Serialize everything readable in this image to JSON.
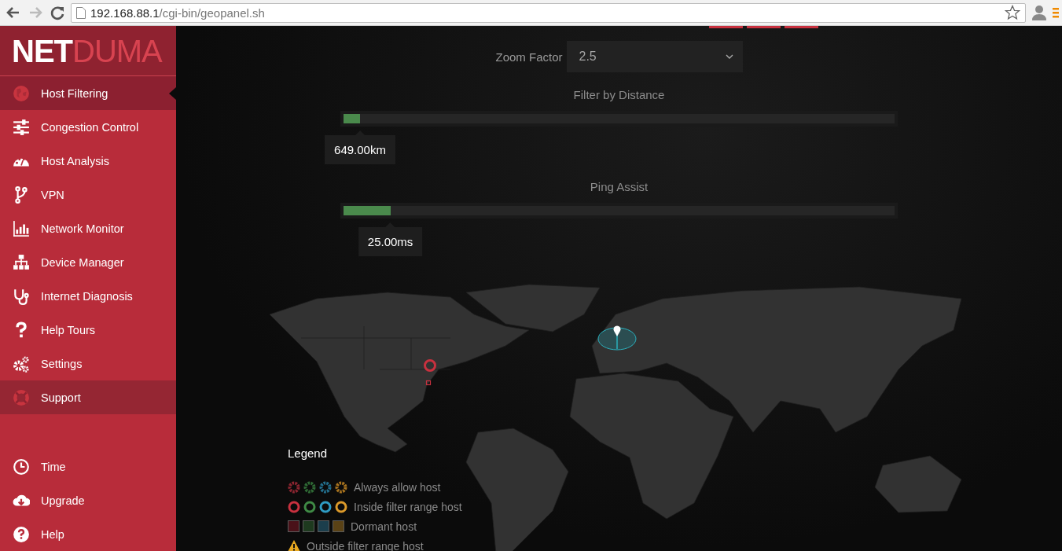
{
  "browser": {
    "url_host": "192.168.88.1",
    "url_path": "/cgi-bin/geopanel.sh",
    "forward_disabled": true
  },
  "sidebar": {
    "logo_strong": "NET",
    "logo_light": "DUMA",
    "items": [
      {
        "label": "Host Filtering",
        "selected": true,
        "hovered": false
      },
      {
        "label": "Congestion Control",
        "selected": false,
        "hovered": false
      },
      {
        "label": "Host Analysis",
        "selected": false,
        "hovered": false
      },
      {
        "label": "VPN",
        "selected": false,
        "hovered": false
      },
      {
        "label": "Network Monitor",
        "selected": false,
        "hovered": false
      },
      {
        "label": "Device Manager",
        "selected": false,
        "hovered": false
      },
      {
        "label": "Internet Diagnosis",
        "selected": false,
        "hovered": false
      },
      {
        "label": "Help Tours",
        "selected": false,
        "hovered": false
      },
      {
        "label": "Settings",
        "selected": false,
        "hovered": false
      },
      {
        "label": "Support",
        "selected": false,
        "hovered": true
      }
    ],
    "bottom_items": [
      {
        "label": "Time"
      },
      {
        "label": "Upgrade"
      },
      {
        "label": "Help"
      }
    ]
  },
  "zoom": {
    "label": "Zoom Factor",
    "value": "2.5"
  },
  "sliders": [
    {
      "label": "Filter by Distance",
      "level": 0.03,
      "reading": "649.00km"
    },
    {
      "label": "Ping Assist",
      "level": 0.085,
      "reading": "25.00ms"
    }
  ],
  "map": {
    "hosts": [
      {
        "kind": "inside",
        "color": "#c8313f"
      },
      {
        "kind": "dormant",
        "color": "#c8313f"
      }
    ]
  },
  "legend": {
    "title": "Legend",
    "rows": [
      {
        "kind": "always",
        "label": "Always allow host",
        "swatches": [
          {
            "color": "#8a2530"
          },
          {
            "color": "#2f6a35"
          },
          {
            "color": "#236e8c"
          },
          {
            "color": "#a8731f"
          }
        ]
      },
      {
        "kind": "inside",
        "label": "Inside filter range host",
        "swatches": [
          {
            "color": "#c8313f"
          },
          {
            "color": "#3f8a45"
          },
          {
            "color": "#2f9cc4"
          },
          {
            "color": "#dc9a2a"
          }
        ]
      },
      {
        "kind": "dormant",
        "label": "Dormant host",
        "swatches": [
          {
            "color": "#4a1219"
          },
          {
            "color": "#1e3a1f"
          },
          {
            "color": "#1b3e4c"
          },
          {
            "color": "#5a4216"
          }
        ]
      },
      {
        "kind": "outside",
        "label": "Outside filter range host",
        "swatches": [
          {
            "color": "#e8a820"
          }
        ]
      }
    ]
  }
}
